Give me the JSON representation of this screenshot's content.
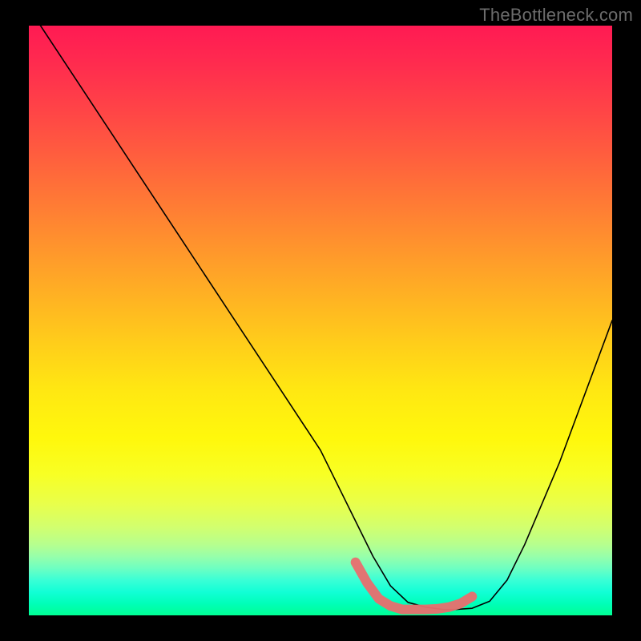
{
  "watermark": "TheBottleneck.com",
  "chart_data": {
    "type": "line",
    "title": "",
    "xlabel": "",
    "ylabel": "",
    "xlim": [
      0,
      100
    ],
    "ylim": [
      0,
      100
    ],
    "grid": false,
    "series": [
      {
        "name": "bottleneck-curve",
        "x": [
          2,
          6,
          10,
          14,
          18,
          22,
          26,
          30,
          34,
          38,
          42,
          46,
          50,
          53,
          56,
          59,
          62,
          65,
          68,
          71,
          73,
          76,
          79,
          82,
          85,
          88,
          91,
          94,
          97,
          100
        ],
        "y": [
          100,
          94,
          88,
          82,
          76,
          70,
          64,
          58,
          52,
          46,
          40,
          34,
          28,
          22,
          16,
          10,
          5,
          2.2,
          1.4,
          1.0,
          1.0,
          1.2,
          2.4,
          6,
          12,
          19,
          26,
          34,
          42,
          50
        ],
        "color": "#000000"
      }
    ],
    "annotations": [
      {
        "name": "highlighted-minimum",
        "x_range": [
          56,
          76
        ],
        "y_at_x": [
          9,
          5.5,
          2.8,
          1.6,
          1.0,
          1.0,
          1.0,
          1.1,
          1.4,
          2.0,
          3.2
        ],
        "color": "#e96e6e",
        "stroke_width": 12
      }
    ]
  }
}
